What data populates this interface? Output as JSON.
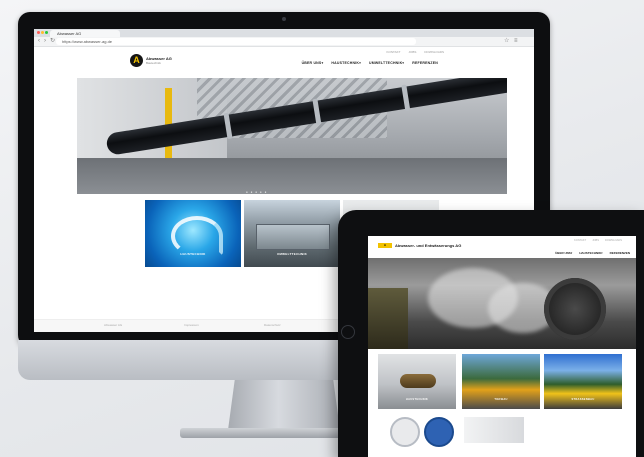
{
  "imac": {
    "tab_title": "Abwasser AG",
    "url": "https://www.abwasser-ag.de",
    "topline": [
      "KONTAKT",
      "JOBS",
      "DOWNLOADS"
    ],
    "logo_letter": "A",
    "brand_name": "Abwasser AG",
    "brand_sub": "Bautechnik",
    "nav": [
      "ÜBER UNS▾",
      "HAUSTECHNIK▾",
      "UMWELTTECHNIK▾",
      "REFERENZEN"
    ],
    "slider_dots": "● ● ● ● ●",
    "tiles": [
      {
        "label": "HAUSTECHNIK"
      },
      {
        "label": "UMWELTTECHNIK"
      },
      {
        "label": ""
      }
    ],
    "footer": [
      "Abwasser AG",
      "Impressum",
      "Datenschutz",
      "Kontakt"
    ]
  },
  "ipad": {
    "logo": "A",
    "brand_name": "Abwasser- und Entwässerungs AG",
    "topline": [
      "KONTAKT",
      "JOBS",
      "DOWNLOADS"
    ],
    "nav": [
      "ÜBER UNS▾",
      "HAUSTECHNIK▾",
      "REFERENZEN"
    ],
    "tiles": [
      {
        "label": "HAUSTECHNIK"
      },
      {
        "label": "TIEFBAU"
      },
      {
        "label": "STRASSENBAU"
      }
    ]
  },
  "colors": {
    "accent": "#f2c200",
    "hero_pipe": "#0c0e11",
    "tile_water": "#2aa7e8"
  }
}
